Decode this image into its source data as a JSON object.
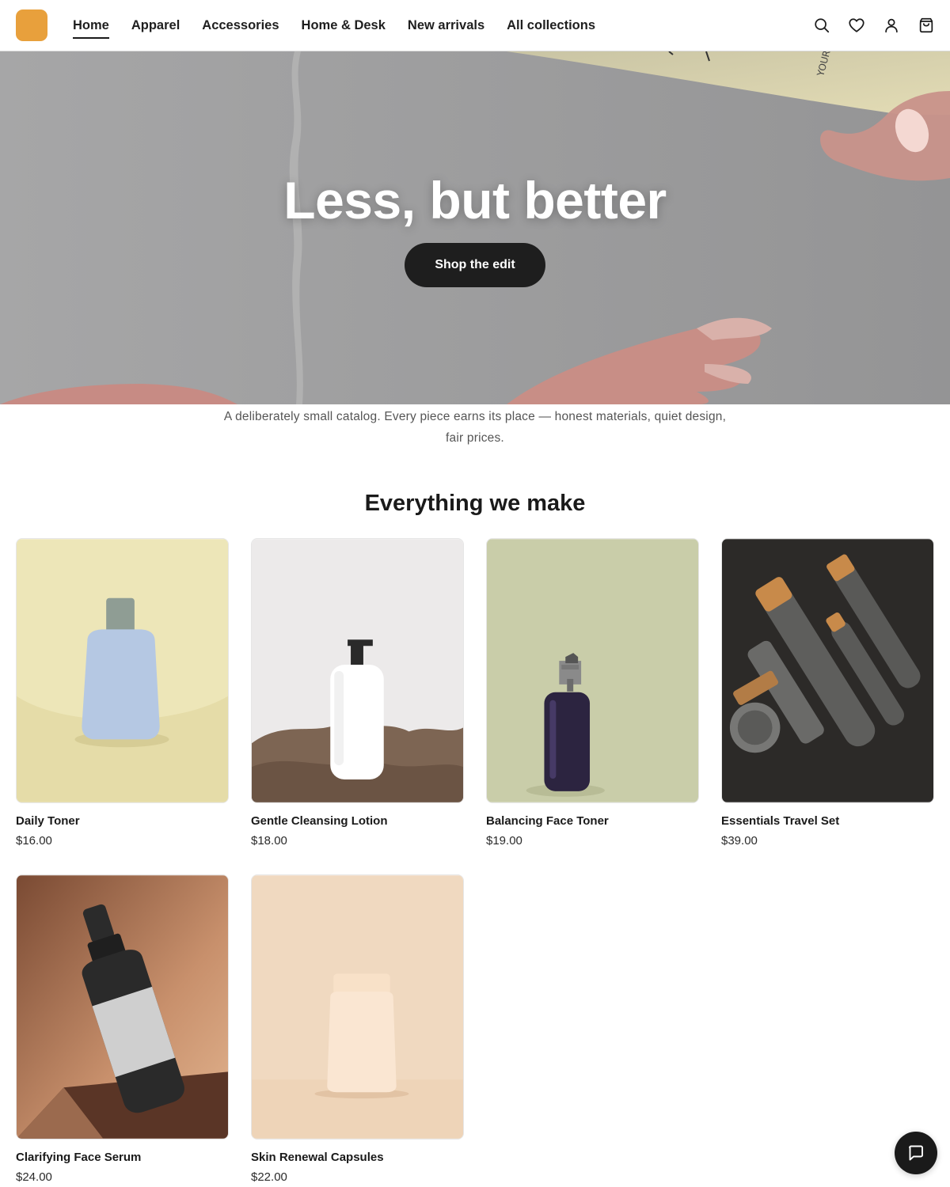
{
  "header": {
    "nav": [
      {
        "label": "Home",
        "active": true
      },
      {
        "label": "Apparel",
        "active": false
      },
      {
        "label": "Accessories",
        "active": false
      },
      {
        "label": "Home & Desk",
        "active": false
      },
      {
        "label": "New arrivals",
        "active": false
      },
      {
        "label": "All collections",
        "active": false
      }
    ],
    "icons": [
      "search-icon",
      "heart-icon",
      "user-icon",
      "bag-icon"
    ],
    "logo_color": "#e8a03c"
  },
  "hero": {
    "title": "Less, but better",
    "cta": "Shop the edit",
    "bottle_text": "YOUR"
  },
  "intro": "A deliberately small catalog. Every piece earns its place — honest materials, quiet design, fair prices.",
  "section": {
    "title": "Everything we make"
  },
  "products": [
    {
      "name": "Daily Toner",
      "price": "$16.00"
    },
    {
      "name": "Gentle Cleansing Lotion",
      "price": "$18.00"
    },
    {
      "name": "Balancing Face Toner",
      "price": "$19.00"
    },
    {
      "name": "Essentials Travel Set",
      "price": "$39.00"
    },
    {
      "name": "Clarifying Face Serum",
      "price": "$24.00"
    },
    {
      "name": "Skin Renewal Capsules",
      "price": "$22.00"
    }
  ],
  "chat": {
    "icon": "chat-icon"
  }
}
